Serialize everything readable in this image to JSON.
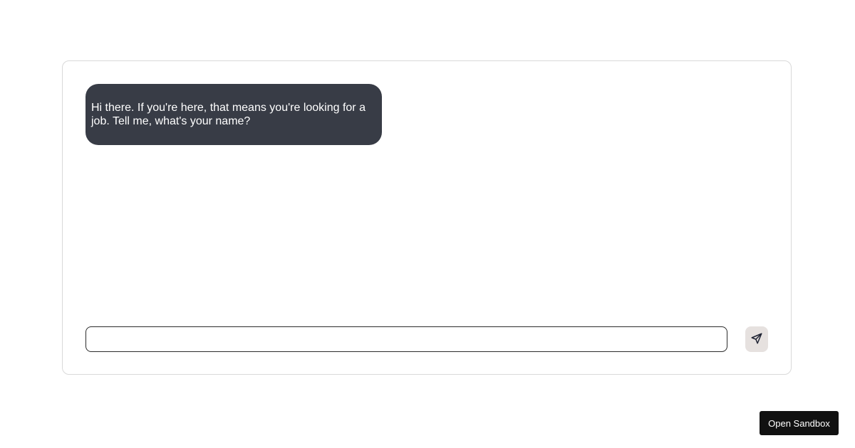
{
  "chat": {
    "messages": [
      {
        "role": "assistant",
        "text": "Hi there. If you're here, that means you're looking for a job. Tell me, what's your name?"
      }
    ],
    "input": {
      "value": "",
      "placeholder": ""
    },
    "send_icon": "send-paper-plane-icon"
  },
  "sandbox": {
    "label": "Open Sandbox"
  },
  "colors": {
    "bubble_background": "#383c46",
    "bubble_text": "#ffffff",
    "send_button_background": "#e6e1df",
    "sandbox_button_background": "#111111"
  }
}
